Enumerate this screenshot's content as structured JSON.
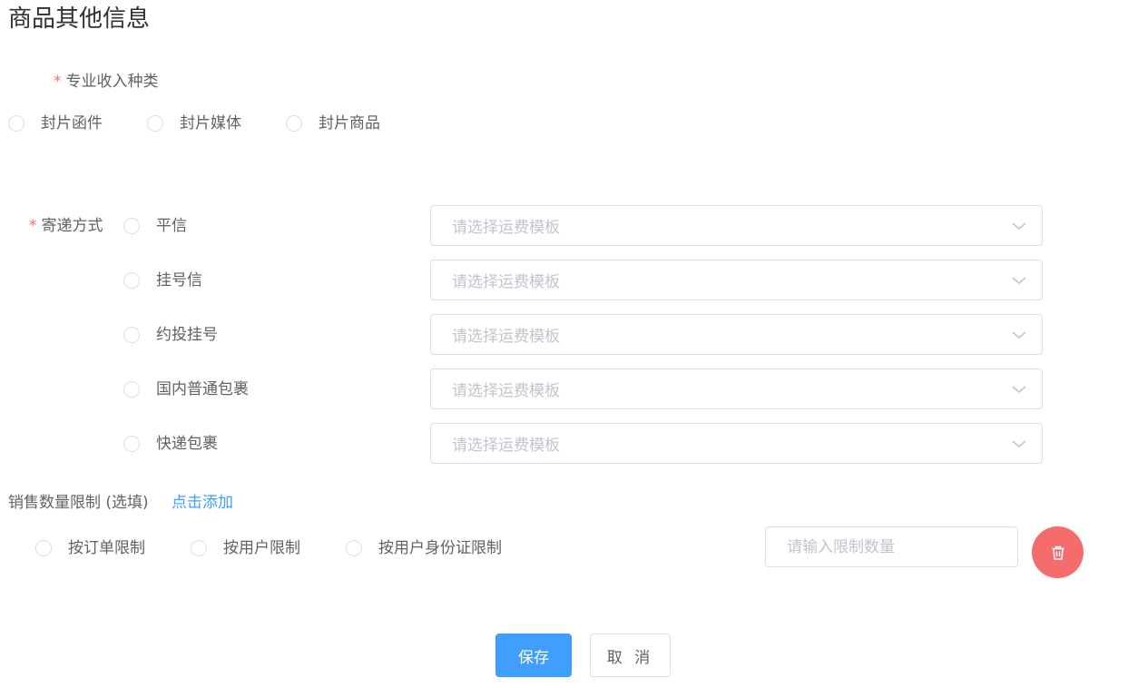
{
  "page_title": "商品其他信息",
  "required_mark": "*",
  "income": {
    "label": "专业收入种类",
    "options": [
      "封片函件",
      "封片媒体",
      "封片商品"
    ]
  },
  "delivery": {
    "label": "寄递方式",
    "methods": [
      {
        "label": "平信",
        "select_placeholder": "请选择运费模板"
      },
      {
        "label": "挂号信",
        "select_placeholder": "请选择运费模板"
      },
      {
        "label": "约投挂号",
        "select_placeholder": "请选择运费模板"
      },
      {
        "label": "国内普通包裹",
        "select_placeholder": "请选择运费模板"
      },
      {
        "label": "快递包裹",
        "select_placeholder": "请选择运费模板"
      }
    ]
  },
  "sales_limit": {
    "label": "销售数量限制 (选填)",
    "add_link": "点击添加",
    "options": [
      "按订单限制",
      "按用户限制",
      "按用户身份证限制"
    ],
    "quantity_placeholder": "请输入限制数量",
    "quantity_value": ""
  },
  "actions": {
    "save_label": "保存",
    "cancel_label": "取 消"
  },
  "icons": {
    "select_arrow": "chevron-down-icon",
    "delete": "trash-icon"
  },
  "colors": {
    "primary": "#409eff",
    "danger": "#f56c6c",
    "required": "#f56c6c",
    "placeholder": "#c0c4cc",
    "border": "#dcdfe6"
  }
}
